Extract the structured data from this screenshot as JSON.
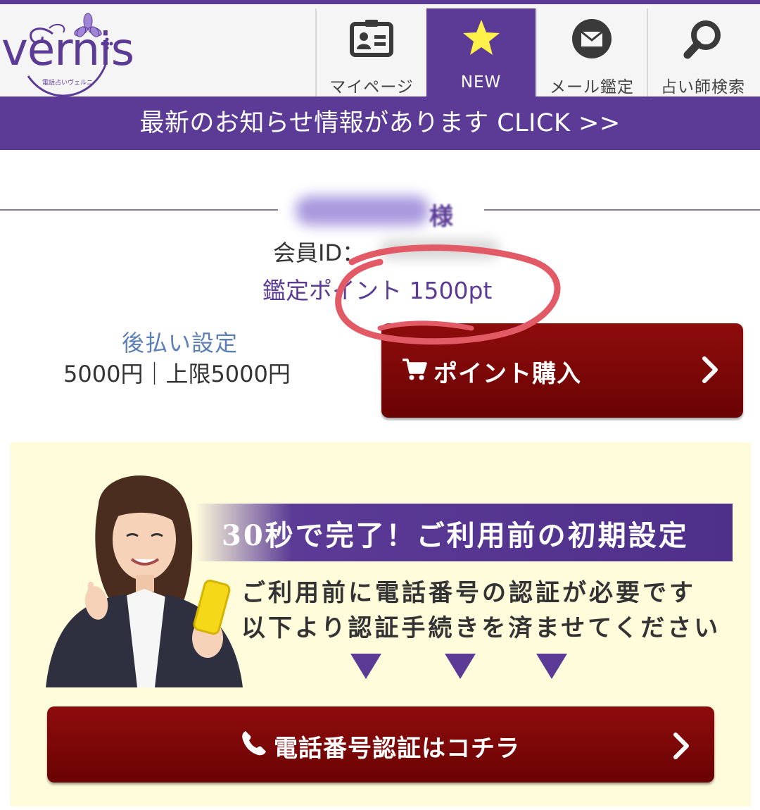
{
  "brand": {
    "logo_text": "vernis",
    "logo_tagline": "電話占いヴェルニ",
    "color_primary": "#5b3b96",
    "color_button": "#7c0606",
    "color_banner_bg": "#fffcdc"
  },
  "nav": {
    "items": [
      {
        "label": "マイページ",
        "icon": "id-card-icon"
      },
      {
        "label": "NEW",
        "icon": "star-icon",
        "active": true
      },
      {
        "label": "メール鑑定",
        "icon": "mail-icon"
      },
      {
        "label": "占い師検索",
        "icon": "search-icon"
      }
    ]
  },
  "news_bar": {
    "text": "最新のお知らせ情報があります CLICK >>"
  },
  "member": {
    "name_suffix": "様",
    "id_label": "会員ID：",
    "points_text": "鑑定ポイント 1500pt",
    "deferred_label": "後払い設定",
    "deferred_amount": "5000円｜上限5000円"
  },
  "purchase_button": {
    "label": "ポイント購入",
    "icon": "cart-icon"
  },
  "banner": {
    "title": "30秒で完了！ご利用前の初期設定",
    "line1": "ご利用前に電話番号の認証が必要です",
    "line2": "以下より認証手続きを済ませてください",
    "button_label": "電話番号認証はコチラ",
    "button_icon": "phone-icon"
  }
}
